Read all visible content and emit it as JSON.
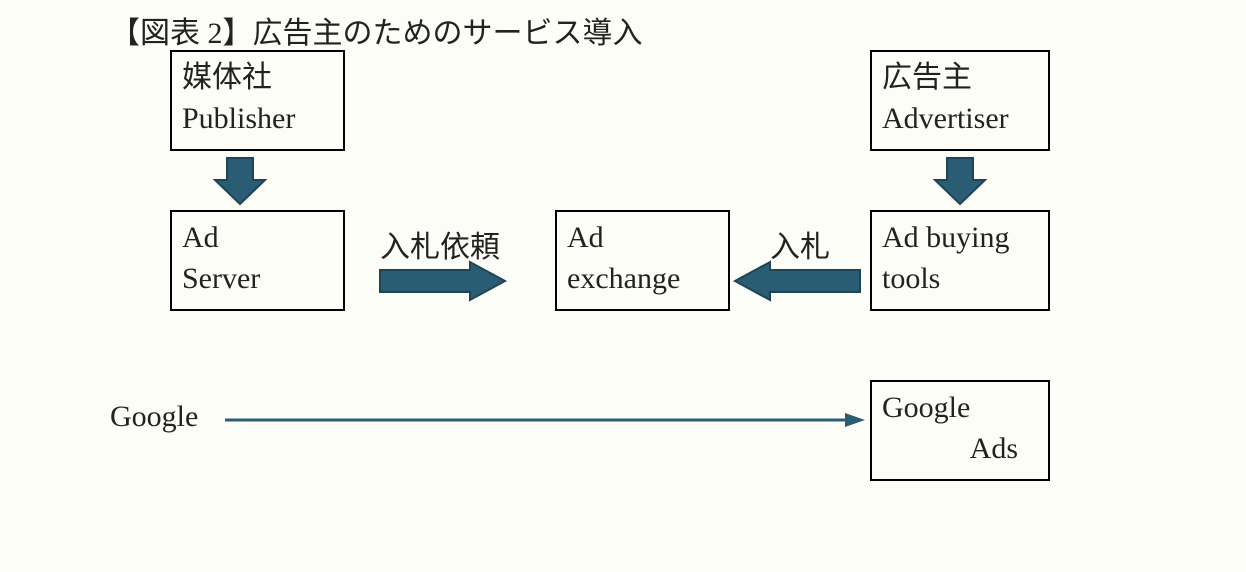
{
  "title": "【図表 2】広告主のためのサービス導入",
  "boxes": {
    "publisher": {
      "line1": "媒体社",
      "line2": "Publisher"
    },
    "advertiser": {
      "line1": "広告主",
      "line2": "Advertiser"
    },
    "adserver": {
      "line1": "Ad",
      "line2": "Server"
    },
    "adexchange": {
      "line1": "Ad",
      "line2": "exchange"
    },
    "adbuying": {
      "line1": "Ad buying",
      "line2": "tools"
    },
    "googleads": {
      "line1": "Google",
      "line2": "Ads"
    }
  },
  "labels": {
    "bidrequest": "入札依頼",
    "bid": "入札",
    "google": "Google"
  }
}
